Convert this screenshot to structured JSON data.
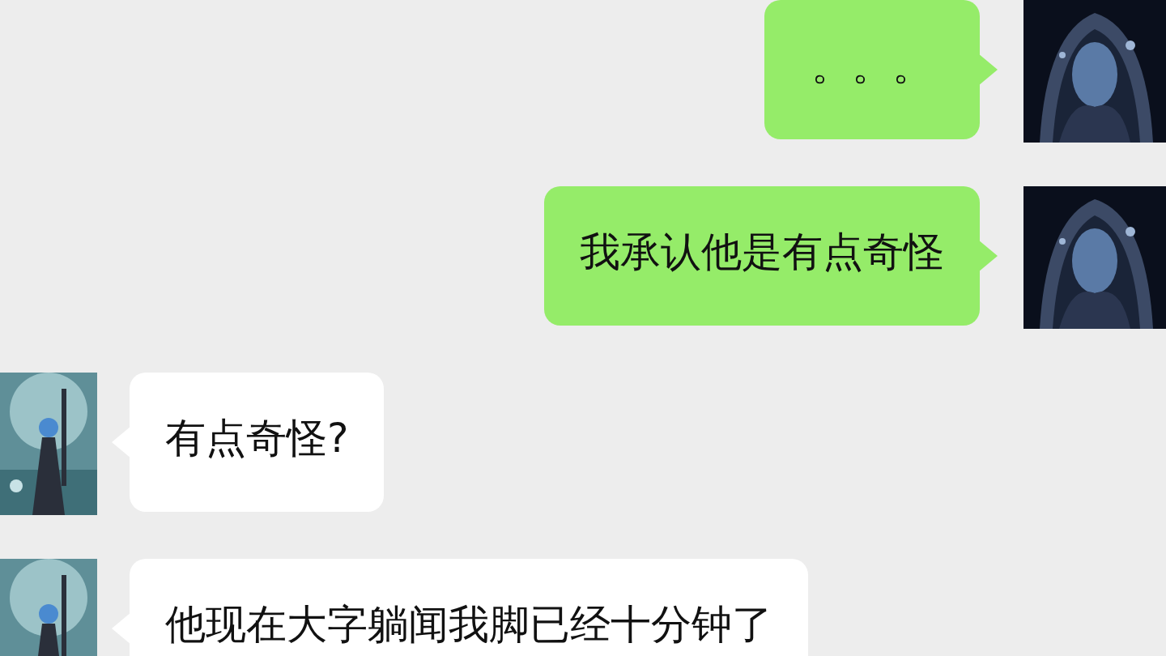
{
  "messages": [
    {
      "kind": "sent",
      "text": "。。。"
    },
    {
      "kind": "sent",
      "text": "我承认他是有点奇怪"
    },
    {
      "kind": "received",
      "text": "有点奇怪?"
    },
    {
      "kind": "received",
      "text": "他现在大字躺闻我脚已经十分钟了"
    }
  ]
}
